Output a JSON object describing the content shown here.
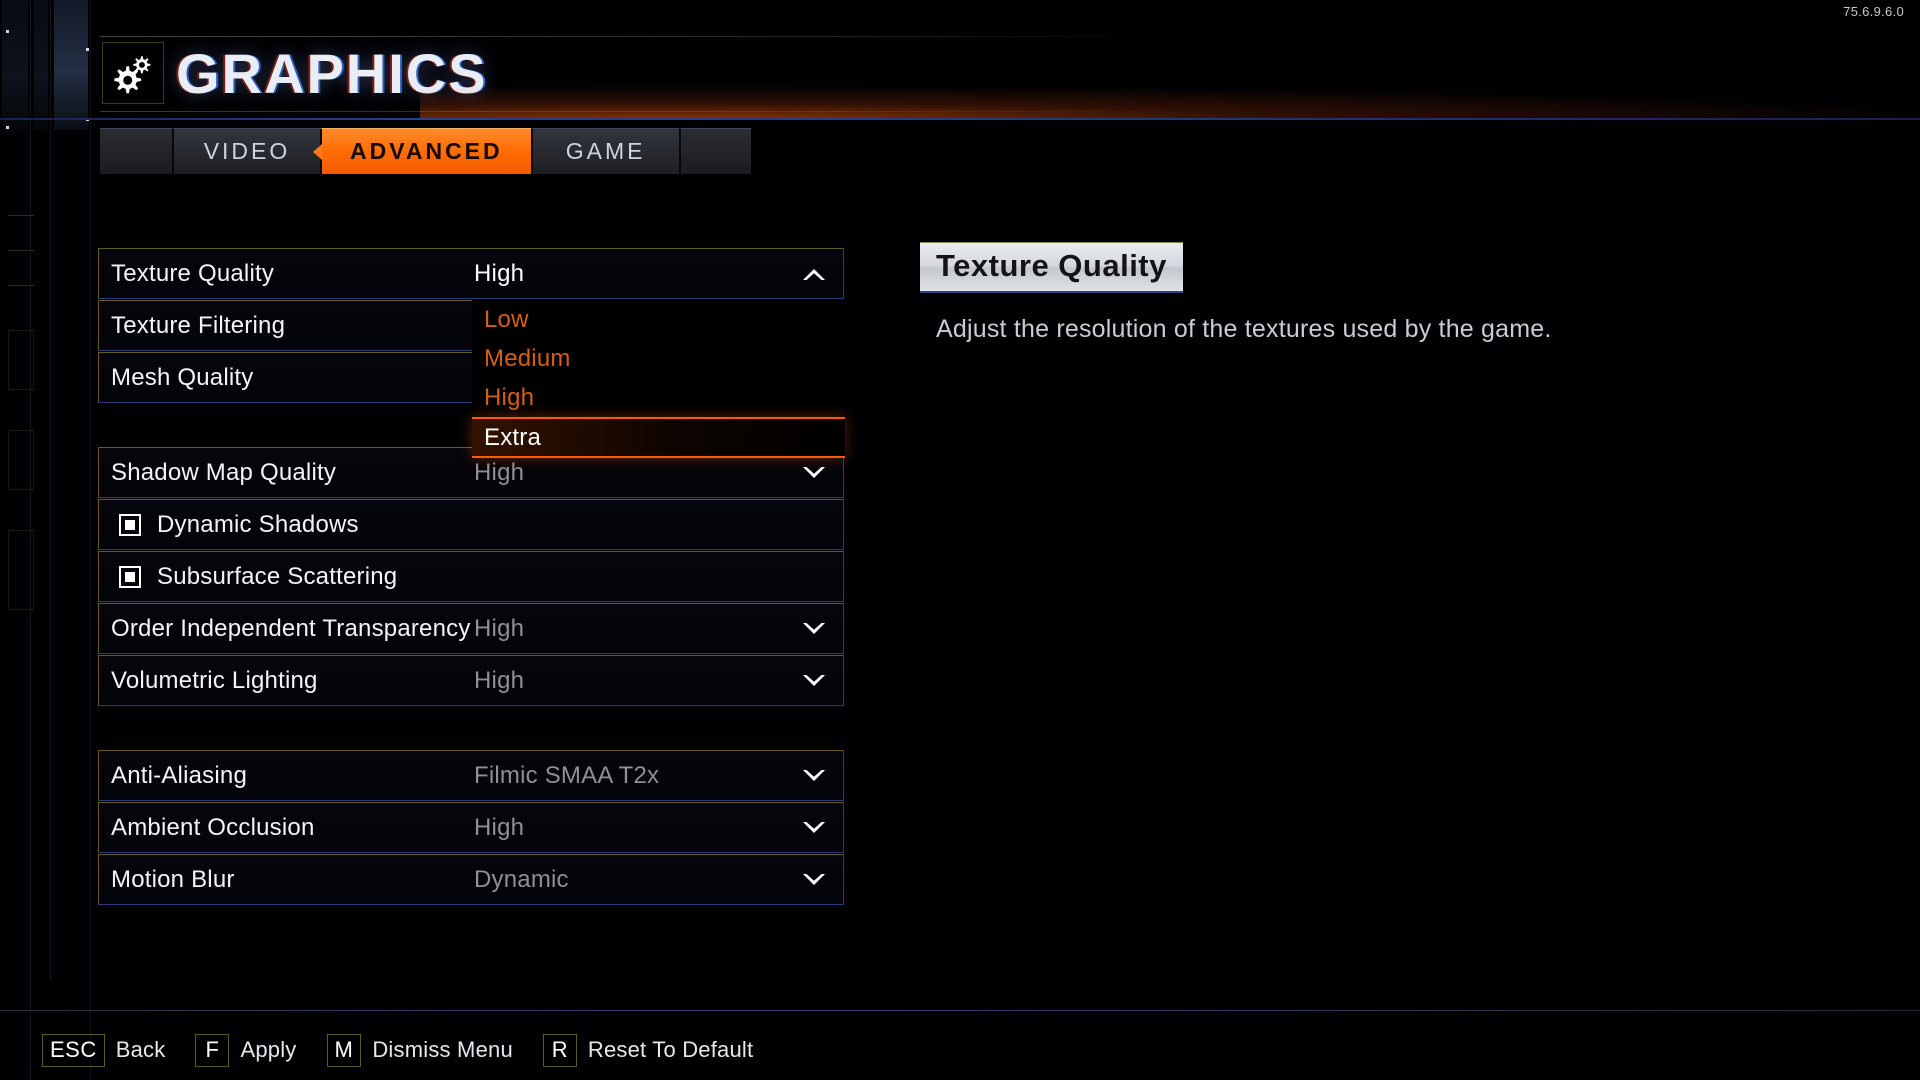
{
  "version": "75.6.9.6.0",
  "header": {
    "title": "GRAPHICS",
    "icon": "gears-icon"
  },
  "tabs": [
    {
      "label": "VIDEO",
      "active": false
    },
    {
      "label": "ADVANCED",
      "active": true
    },
    {
      "label": "GAME",
      "active": false
    }
  ],
  "settings": {
    "group1": [
      {
        "label": "Texture Quality",
        "value": "High",
        "type": "dropdown",
        "open": true
      },
      {
        "label": "Texture Filtering",
        "value": "",
        "type": "dropdown",
        "open": false
      },
      {
        "label": "Mesh Quality",
        "value": "",
        "type": "dropdown",
        "open": false
      }
    ],
    "group2": [
      {
        "label": "Shadow Map Quality",
        "value": "High",
        "type": "dropdown"
      },
      {
        "label": "Dynamic Shadows",
        "value": "",
        "type": "checkbox",
        "checked": true
      },
      {
        "label": "Subsurface Scattering",
        "value": "",
        "type": "checkbox",
        "checked": true
      },
      {
        "label": "Order Independent Transparency",
        "value": "High",
        "type": "dropdown"
      },
      {
        "label": "Volumetric Lighting",
        "value": "High",
        "type": "dropdown"
      }
    ],
    "group3": [
      {
        "label": "Anti-Aliasing",
        "value": "Filmic SMAA T2x",
        "type": "dropdown"
      },
      {
        "label": "Ambient Occlusion",
        "value": "High",
        "type": "dropdown"
      },
      {
        "label": "Motion Blur",
        "value": "Dynamic",
        "type": "dropdown"
      }
    ]
  },
  "dropdown": {
    "owner": "Texture Quality",
    "options": [
      {
        "label": "Low",
        "selected": false
      },
      {
        "label": "Medium",
        "selected": false
      },
      {
        "label": "High",
        "selected": false
      },
      {
        "label": "Extra",
        "selected": true
      }
    ]
  },
  "info": {
    "title": "Texture Quality",
    "description": "Adjust the resolution of the textures used by the game."
  },
  "bottom_hints": [
    {
      "key": "ESC",
      "label": "Back"
    },
    {
      "key": "F",
      "label": "Apply"
    },
    {
      "key": "M",
      "label": "Dismiss Menu"
    },
    {
      "key": "R",
      "label": "Reset To Default"
    }
  ],
  "colors": {
    "accent_orange": "#ff6a00",
    "dropdown_text": "#d2600f",
    "row_border_top": "#6a5a1e",
    "row_border_bottom": "#2b3a7a"
  }
}
